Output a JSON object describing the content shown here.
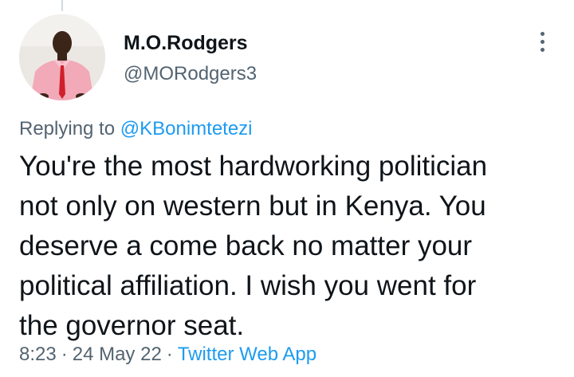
{
  "author": {
    "display_name": "M.O.Rodgers",
    "handle": "@MORodgers3",
    "avatar_icon": "profile-photo"
  },
  "more_icon": "more-vertical-icon",
  "reply_context": {
    "prefix": "Replying to ",
    "mention": "@KBonimtetezi"
  },
  "tweet": {
    "lines": [
      "You're the most hardworking politician",
      "not only on western but in Kenya. You",
      "deserve a come back no matter your",
      "political affiliation. I wish you went for",
      "the governor seat."
    ]
  },
  "meta": {
    "time": "8:23",
    "separator": "·",
    "date": "24 May 22",
    "source": "Twitter Web App"
  },
  "colors": {
    "text": "#0f1419",
    "secondary": "#536471",
    "link": "#1d9bf0"
  }
}
